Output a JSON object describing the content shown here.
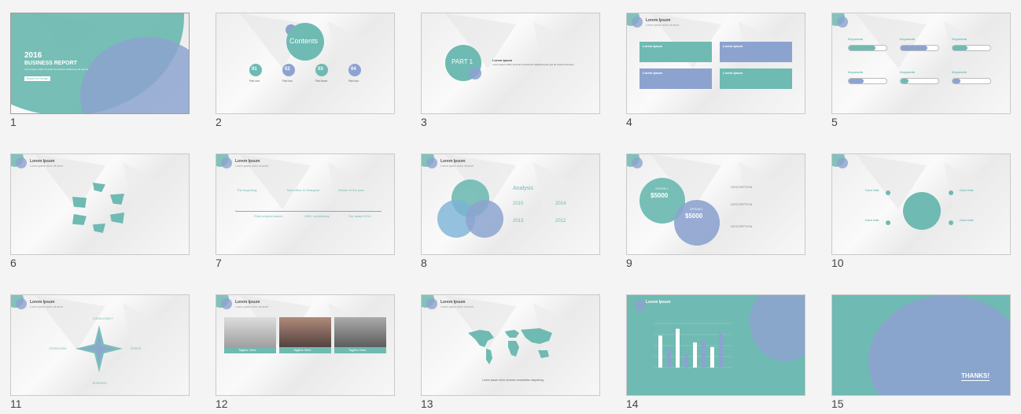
{
  "slides": [
    {
      "num": "1"
    },
    {
      "num": "2"
    },
    {
      "num": "3"
    },
    {
      "num": "4"
    },
    {
      "num": "5"
    },
    {
      "num": "6"
    },
    {
      "num": "7"
    },
    {
      "num": "8"
    },
    {
      "num": "9"
    },
    {
      "num": "10"
    },
    {
      "num": "11"
    },
    {
      "num": "12"
    },
    {
      "num": "13"
    },
    {
      "num": "14"
    },
    {
      "num": "15"
    }
  ],
  "s1": {
    "year": "2016",
    "title": "BUSINESS REPORT",
    "btn": "Report for Design"
  },
  "s2": {
    "title": "Contents",
    "items": [
      "01",
      "02",
      "03",
      "04"
    ],
    "labels": [
      "Part one",
      "Part two",
      "Part three",
      "Part four"
    ]
  },
  "s3": {
    "title": "PART 1",
    "heading": "Lorem Ipsum"
  },
  "common": {
    "heading": "Lorem Ipsum",
    "sub": "Lorem ipsum dolor sit amet"
  },
  "s4": {
    "boxes": [
      "Lorem Ipsum",
      "Lorem Ipsum",
      "Lorem Ipsum",
      "Lorem Ipsum"
    ]
  },
  "s5": {
    "keywords": [
      "Keywords",
      "Keywords",
      "Keywords",
      "Keywords",
      "Keywords",
      "Keywords"
    ],
    "percents": [
      "70%",
      "70%",
      "40%",
      "40%",
      "20%",
      "20%"
    ]
  },
  "s6": {
    "nums": [
      "01",
      "02",
      "03",
      "04",
      "05",
      "06"
    ]
  },
  "s7": {
    "years": [
      "2009",
      "2012",
      "2015",
      "2011",
      "2013",
      "2020"
    ],
    "titles": [
      "The beginning",
      "New office in Shanghai",
      "Winner of the year",
      "Prize product launch",
      "10th+ anniversary",
      "Our award 2014"
    ]
  },
  "s8": {
    "title": "Analysis",
    "years": [
      "2015",
      "2014",
      "2013",
      "2012"
    ]
  },
  "s9": {
    "opt1": "OPTION 1",
    "val1": "$5000",
    "opt2": "OPTION 2",
    "val2": "$5000",
    "desc": "DESCRIPTION"
  },
  "s10": {
    "labels": [
      "Core Info",
      "Core Info",
      "Core Info",
      "Core Info"
    ]
  },
  "s11": {
    "labels": [
      "CONSULTANCY",
      "CONSULTING",
      "DESIGN",
      "BUSINESS"
    ]
  },
  "s12": {
    "tags": [
      "Tagline Here",
      "Tagline Here",
      "Tagline Here"
    ]
  },
  "s14": {
    "values": [
      70,
      40,
      85,
      30,
      55,
      60,
      45,
      75
    ],
    "ylim": [
      0,
      100
    ]
  },
  "s15": {
    "thanks": "THANKS!"
  }
}
